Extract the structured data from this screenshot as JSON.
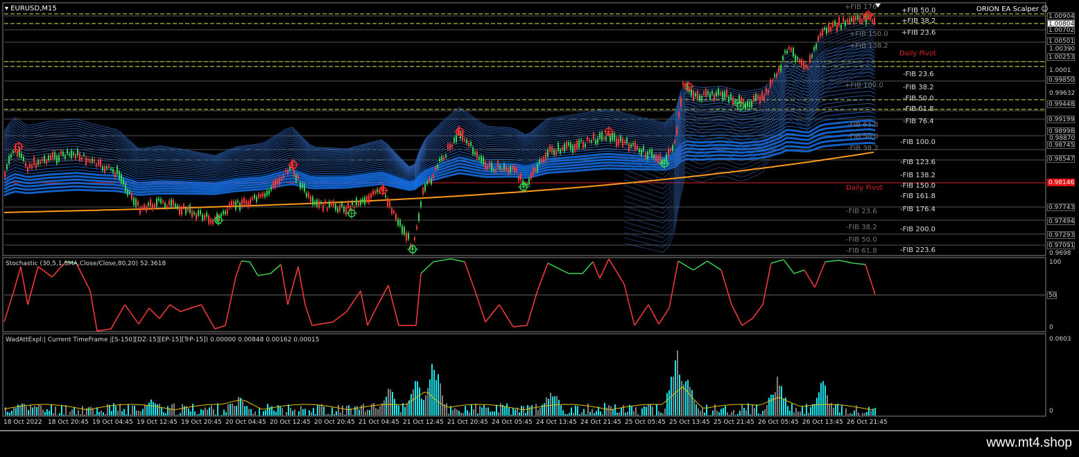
{
  "chart": {
    "symbol": "EURUSD,M15",
    "ea_name": "ORION EA Scalper",
    "brand": "www.mt4.shop"
  },
  "fib_right_plus": [
    "+FIB 50.0",
    "+FIB 38.2",
    "+FIB 23.6"
  ],
  "pivot_label": "Daily Pivot",
  "pivot_label_2": "Daily Pivot",
  "fib_right_minus": [
    "-FIB 23.6",
    "-FIB 38.2",
    "-FIB 50.0",
    "-FIB 61.8",
    "-FIB 76.4",
    "-FIB 100.0",
    "-FIB 123.6",
    "-FIB 138.2",
    "-FIB 150.0",
    "-FIB 161.8",
    "-FIB 176.4",
    "-FIB 200.0",
    "-FIB 223.6"
  ],
  "fib_gray_top": [
    "+FIB 176",
    "+FIB 150.0",
    "+FIB 138.2",
    "+FIB 100.0",
    "-FIB 61.8",
    "-FIB 50.0",
    "-FIB 38.2"
  ],
  "fib_gray_bottom": [
    "-FIB 23.6",
    "-FIB 38.2",
    "-FIB 50.0",
    "-FIB 61.8"
  ],
  "price_boxes": [
    "1.00904",
    "1.00804",
    "1.00702",
    "1.00501",
    "1.00253",
    "0.99850",
    "0.99448",
    "0.99199",
    "0.98998",
    "0.98745",
    "0.98547",
    "0.98146",
    "0.97743",
    "0.97494",
    "0.97293",
    "0.97091"
  ],
  "price_axis": [
    "1.00390",
    "1.0001",
    "0.99632",
    "0.98870",
    "0.9698"
  ],
  "stochastic": {
    "title": "Stochastic (30,5,1,SMA,Close/Close,80,20) 52.3618",
    "max": "100",
    "mid": "50",
    "min": "0"
  },
  "wad": {
    "title": "WadAttExpl:| Current TimeFrame |[S-150][DZ-15][EP-15][TrP-15]) 0.00000 0.00848 0.00162 0.00015",
    "max": "0.0603",
    "min": "0"
  },
  "time_labels": [
    "18 Oct 2022",
    "18 Oct 20:45",
    "19 Oct 04:45",
    "19 Oct 12:45",
    "19 Oct 20:45",
    "20 Oct 04:45",
    "20 Oct 12:45",
    "20 Oct 20:45",
    "21 Oct 04:45",
    "21 Oct 12:45",
    "21 Oct 20:45",
    "24 Oct 05:45",
    "24 Oct 13:45",
    "24 Oct 21:45",
    "25 Oct 05:45",
    "25 Oct 13:45",
    "25 Oct 21:45",
    "26 Oct 05:45",
    "26 Oct 13:45",
    "26 Oct 21:45"
  ],
  "colors": {
    "bull": "#39d353",
    "bear": "#ff3b3b",
    "ribbon": "#1e88ff",
    "ma": "#ff9a1a",
    "fibline": "#e6e64a",
    "pivot": "#e02020",
    "wad_hist": "#18e8f0",
    "wad_gray": "#808080",
    "wad_line": "#e6c200"
  }
}
